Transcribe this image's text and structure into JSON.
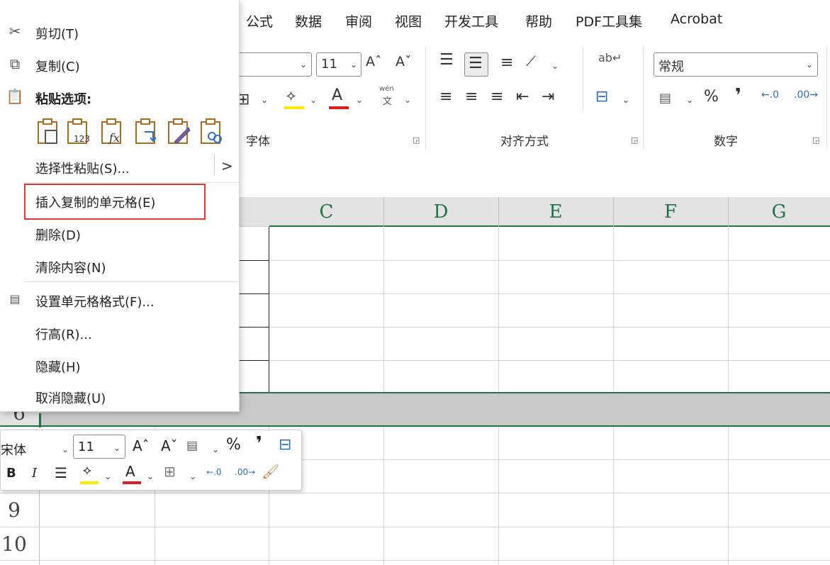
{
  "ribbon": {
    "tabs": [
      "公式",
      "数据",
      "审阅",
      "视图",
      "开发工具",
      "帮助",
      "PDF工具集",
      "Acrobat"
    ],
    "font_size": "11",
    "number_format": "常规",
    "groups": [
      "字体",
      "对齐方式",
      "数字"
    ],
    "phonetic_label": "wén",
    "phonetic_char": "文",
    "percent": "%",
    "comma": "❜",
    "grow_font": "Aˆ",
    "shrink_font": "Aˇ"
  },
  "sheet": {
    "columns": [
      "C",
      "D",
      "E",
      "F",
      "G"
    ],
    "rows": [
      "6",
      "9",
      "10"
    ]
  },
  "context_menu": {
    "items": [
      {
        "label": "剪切(T)",
        "icon": "scissors-icon"
      },
      {
        "label": "复制(C)",
        "icon": "copy-icon"
      },
      {
        "label": "粘贴选项:",
        "icon": "clipboard-icon"
      },
      {
        "label": "选择性粘贴(S)...",
        "icon": ""
      },
      {
        "label": "插入复制的单元格(E)",
        "icon": ""
      },
      {
        "label": "删除(D)",
        "icon": ""
      },
      {
        "label": "清除内容(N)",
        "icon": ""
      },
      {
        "label": "设置单元格格式(F)...",
        "icon": "format-cells-icon"
      },
      {
        "label": "行高(R)...",
        "icon": ""
      },
      {
        "label": "隐藏(H)",
        "icon": ""
      },
      {
        "label": "取消隐藏(U)",
        "icon": ""
      }
    ],
    "paste_submenu_arrow": ">",
    "paste_options": [
      "paste-icon",
      "paste-values-icon",
      "paste-formulas-icon",
      "paste-transpose-icon",
      "paste-formatting-icon",
      "paste-link-icon"
    ],
    "paste_values_label": "123",
    "paste_formula_label": "fx"
  },
  "mini_toolbar": {
    "font_name": "宋体",
    "font_size": "11",
    "bold": "B",
    "italic": "I",
    "percent": "%",
    "comma": "❜",
    "grow_font": "Aˆ",
    "shrink_font": "Aˇ"
  },
  "colors": {
    "accent_green": "#217346",
    "highlight_red": "#e03a2f",
    "fill_yellow": "#ffe800",
    "font_red": "#e31b1b"
  }
}
